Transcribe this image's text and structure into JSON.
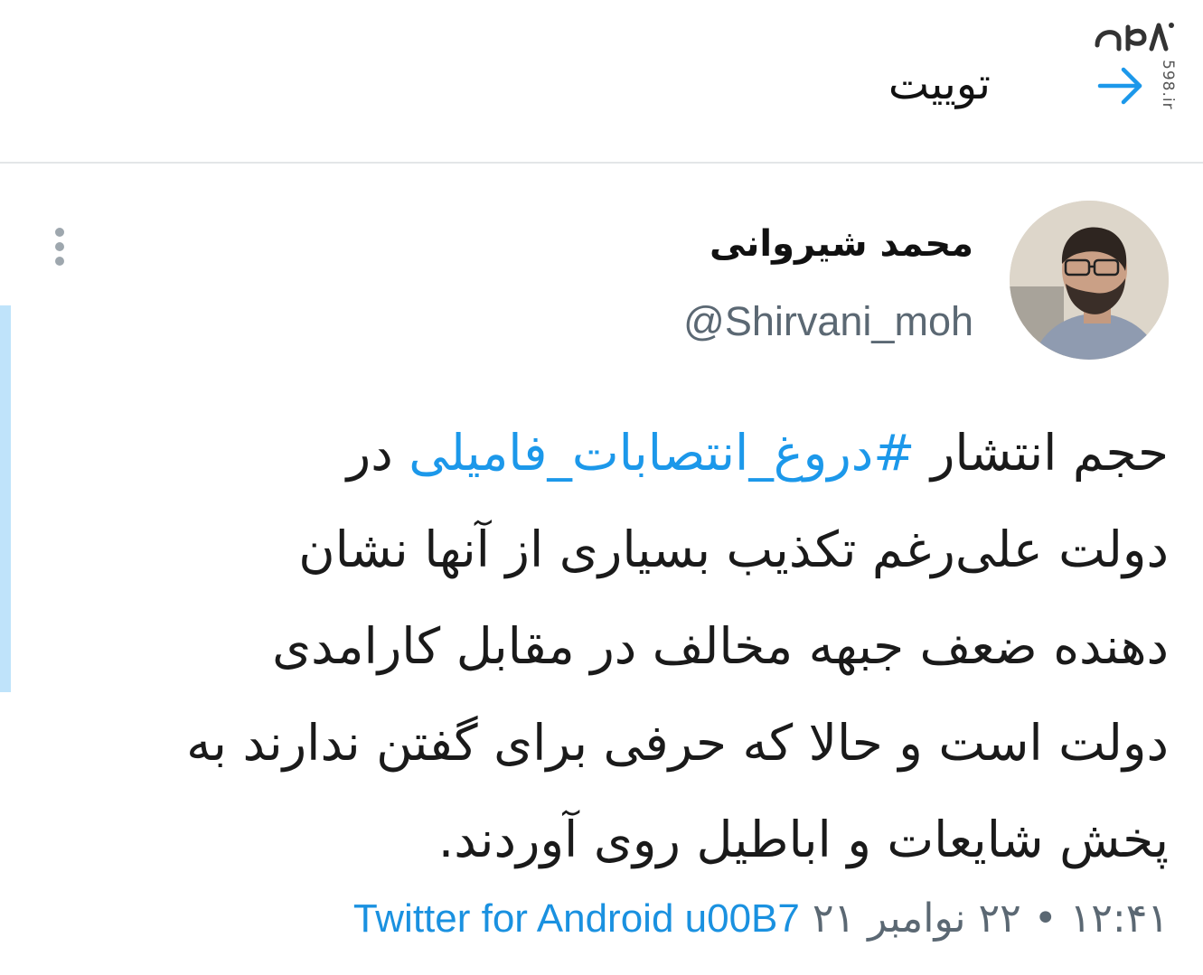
{
  "header": {
    "title": "توییت",
    "watermark_logo": "۵۹۸",
    "watermark_url": "598.ir"
  },
  "tweet": {
    "author_name": "محمد شیروانی",
    "author_handle": "@Shirvani_moh",
    "body_lines": [
      {
        "pre": "حجم انتشار ",
        "hashtag": "#دروغ_انتصابات_فامیلی",
        "post": " در"
      },
      {
        "text": "دولت علی‌رغم تکذیب بسیاری از آنها نشان"
      },
      {
        "text": "دهنده ضعف جبهه مخالف در مقابل کارامدی"
      },
      {
        "text": "دولت است و حالا که حرفی برای گفتن ندارند به"
      },
      {
        "text": "پخش شایعات و اباطیل روی آوردند."
      }
    ],
    "datetime": "۱۲:۴۱ • ۲۲ نوامبر ۲۱",
    "source": "Twitter for Android u00B7"
  },
  "colors": {
    "accent": "#1c98ea",
    "muted": "#5b6873",
    "divider": "#e3e6e8",
    "side_bar": "#bfe3fa"
  },
  "icons": {
    "back": "arrow-right-icon",
    "menu": "kebab-menu-icon"
  }
}
